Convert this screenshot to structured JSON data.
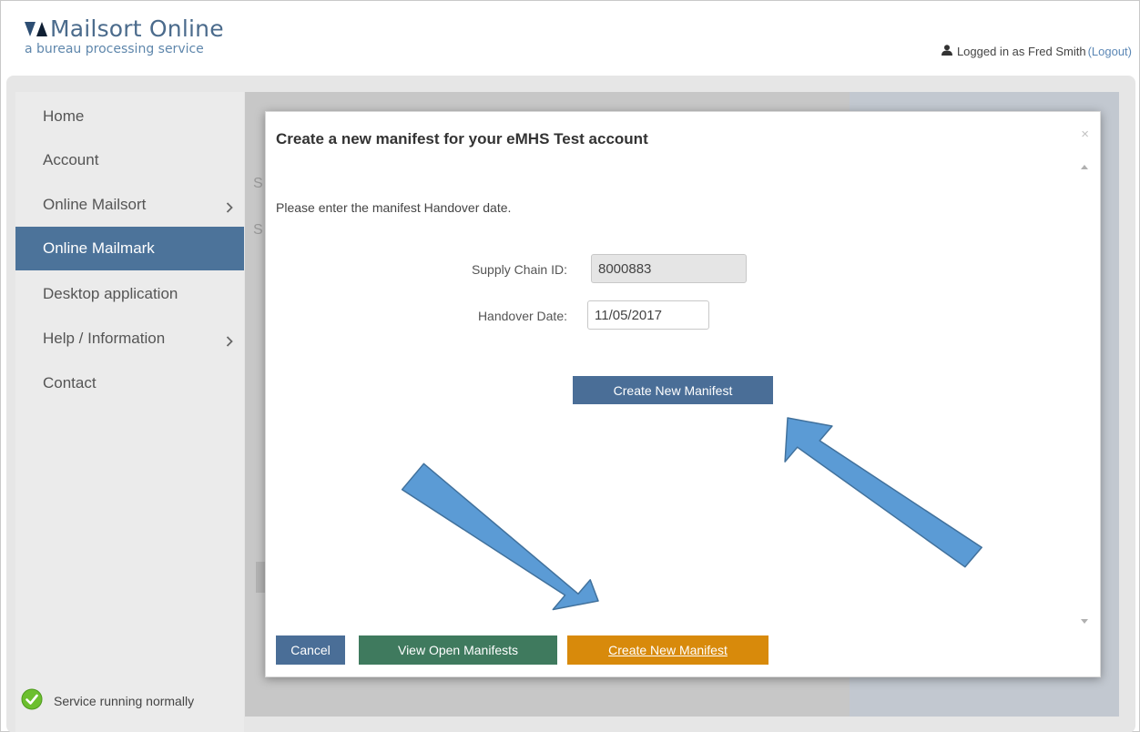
{
  "header": {
    "app_title": "Mailsort Online",
    "app_subtitle": "a bureau processing service",
    "user_prefix": "Logged in as Fred Smith",
    "logout_label": "(Logout)"
  },
  "sidebar": {
    "items": [
      {
        "label": "Home"
      },
      {
        "label": "Account"
      },
      {
        "label": "Online Mailsort"
      },
      {
        "label": "Online Mailmark"
      },
      {
        "label": "Desktop application"
      },
      {
        "label": "Help / Information"
      },
      {
        "label": "Contact"
      }
    ],
    "status_text": "Service running normally"
  },
  "background": {
    "ghost_s1": "S",
    "ghost_s2": "S"
  },
  "modal": {
    "title": "Create a new manifest for your eMHS Test account",
    "close_glyph": "×",
    "instruction": "Please enter the manifest Handover date.",
    "supply_chain_label": "Supply Chain ID:",
    "supply_chain_value": "8000883",
    "handover_label": "Handover Date:",
    "handover_value": "11/05/2017",
    "create_inline_label": "Create New Manifest",
    "footer": {
      "cancel_label": "Cancel",
      "view_open_label": "View Open Manifests",
      "create_label": "Create New Manifest"
    }
  },
  "colors": {
    "active_nav": "#4c739a",
    "primary_button": "#4a6e97",
    "green_button": "#3f7a5e",
    "orange_button": "#d88a0b",
    "annotation_arrow": "#5b9bd5"
  }
}
